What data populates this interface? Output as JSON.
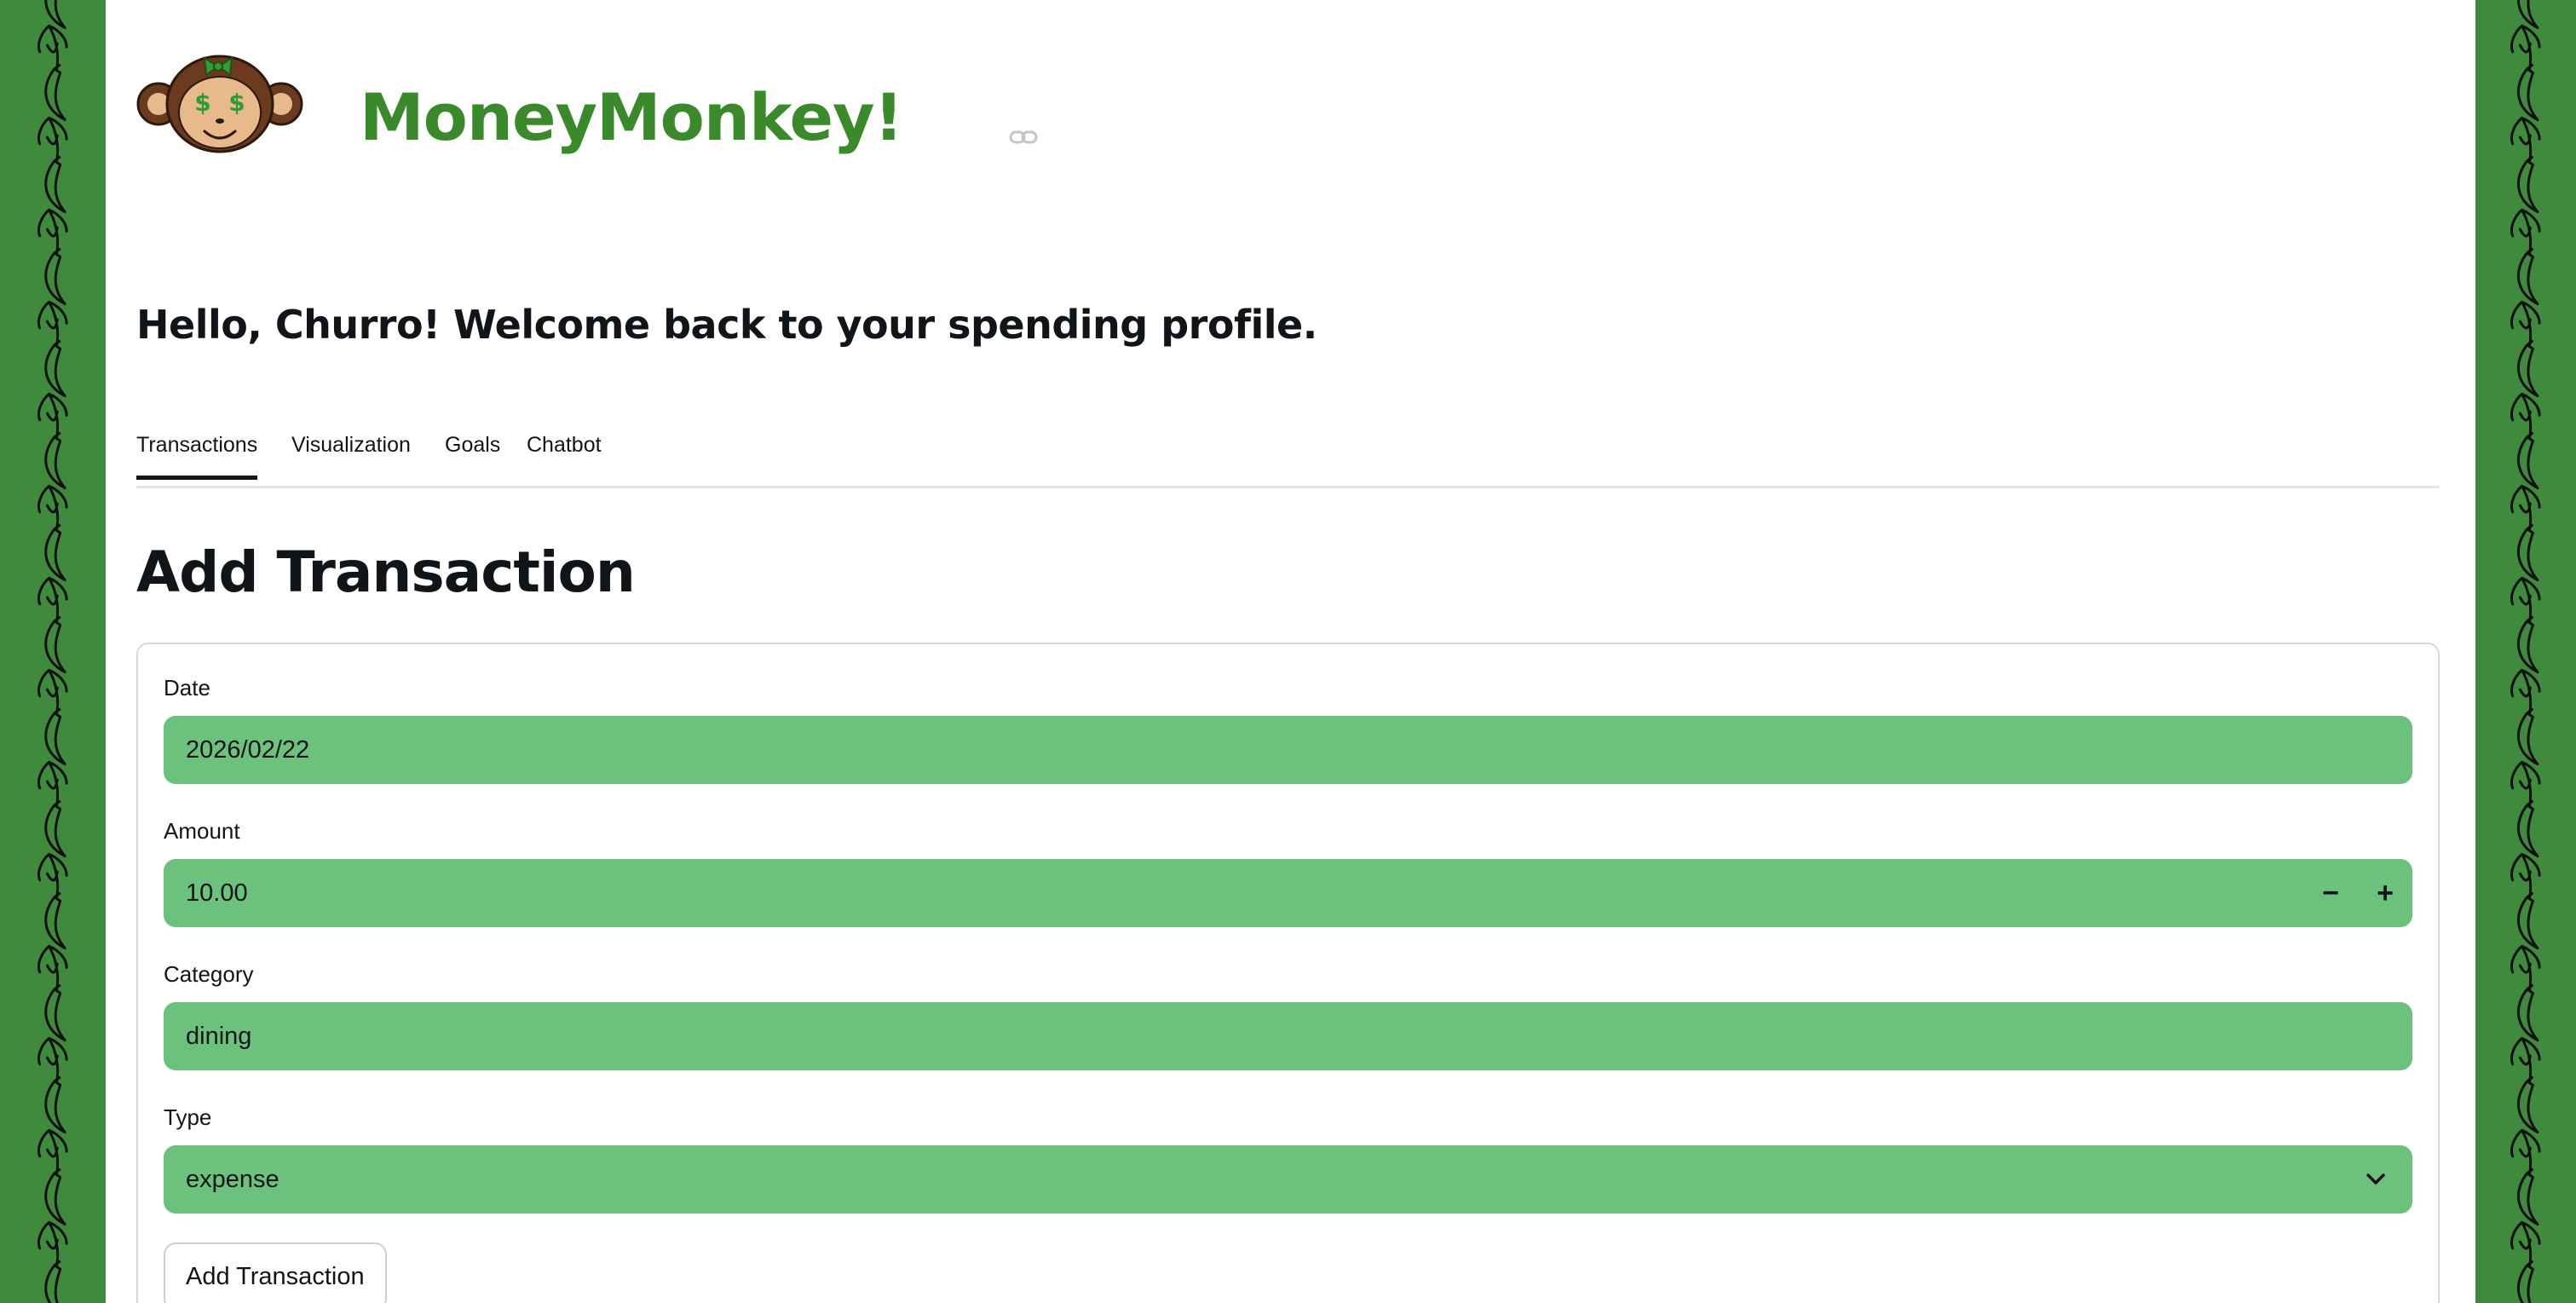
{
  "app": {
    "title": "MoneyMonkey!",
    "logo_icon": "monkey-dollar-eyes-logo",
    "anchor_icon": "link-icon",
    "brand_color": "#3a8a2c",
    "field_color": "#6cc27c",
    "background_pattern": "banana-icon"
  },
  "greeting": "Hello, Churro! Welcome back to your spending profile.",
  "tabs": [
    {
      "label": "Transactions",
      "active": true
    },
    {
      "label": "Visualization",
      "active": false
    },
    {
      "label": "Goals",
      "active": false
    },
    {
      "label": "Chatbot",
      "active": false
    }
  ],
  "form": {
    "heading": "Add Transaction",
    "date": {
      "label": "Date",
      "value": "2026/02/22"
    },
    "amount": {
      "label": "Amount",
      "value": "10.00",
      "decrement": "−",
      "increment": "+"
    },
    "category": {
      "label": "Category",
      "value": "dining"
    },
    "type": {
      "label": "Type",
      "value": "expense",
      "icon": "chevron-down-icon"
    },
    "submit_label": "Add Transaction"
  }
}
